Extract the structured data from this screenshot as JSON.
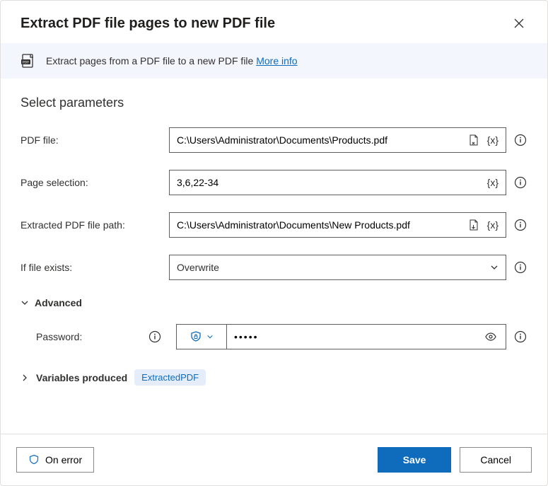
{
  "header": {
    "title": "Extract PDF file pages to new PDF file"
  },
  "infobar": {
    "text": "Extract pages from a PDF file to a new PDF file ",
    "link_label": "More info"
  },
  "section_title": "Select parameters",
  "fields": {
    "pdf_file": {
      "label": "PDF file:",
      "value": "C:\\Users\\Administrator\\Documents\\Products.pdf"
    },
    "page_selection": {
      "label": "Page selection:",
      "value": "3,6,22-34"
    },
    "extracted_path": {
      "label": "Extracted PDF file path:",
      "value": "C:\\Users\\Administrator\\Documents\\New Products.pdf"
    },
    "if_exists": {
      "label": "If file exists:",
      "selected": "Overwrite"
    }
  },
  "advanced": {
    "label": "Advanced",
    "password": {
      "label": "Password:",
      "value": "•••••"
    }
  },
  "variables": {
    "label": "Variables produced",
    "badge": "ExtractedPDF"
  },
  "footer": {
    "on_error": "On error",
    "save": "Save",
    "cancel": "Cancel"
  },
  "tokens": {
    "var_token": "{x}"
  }
}
